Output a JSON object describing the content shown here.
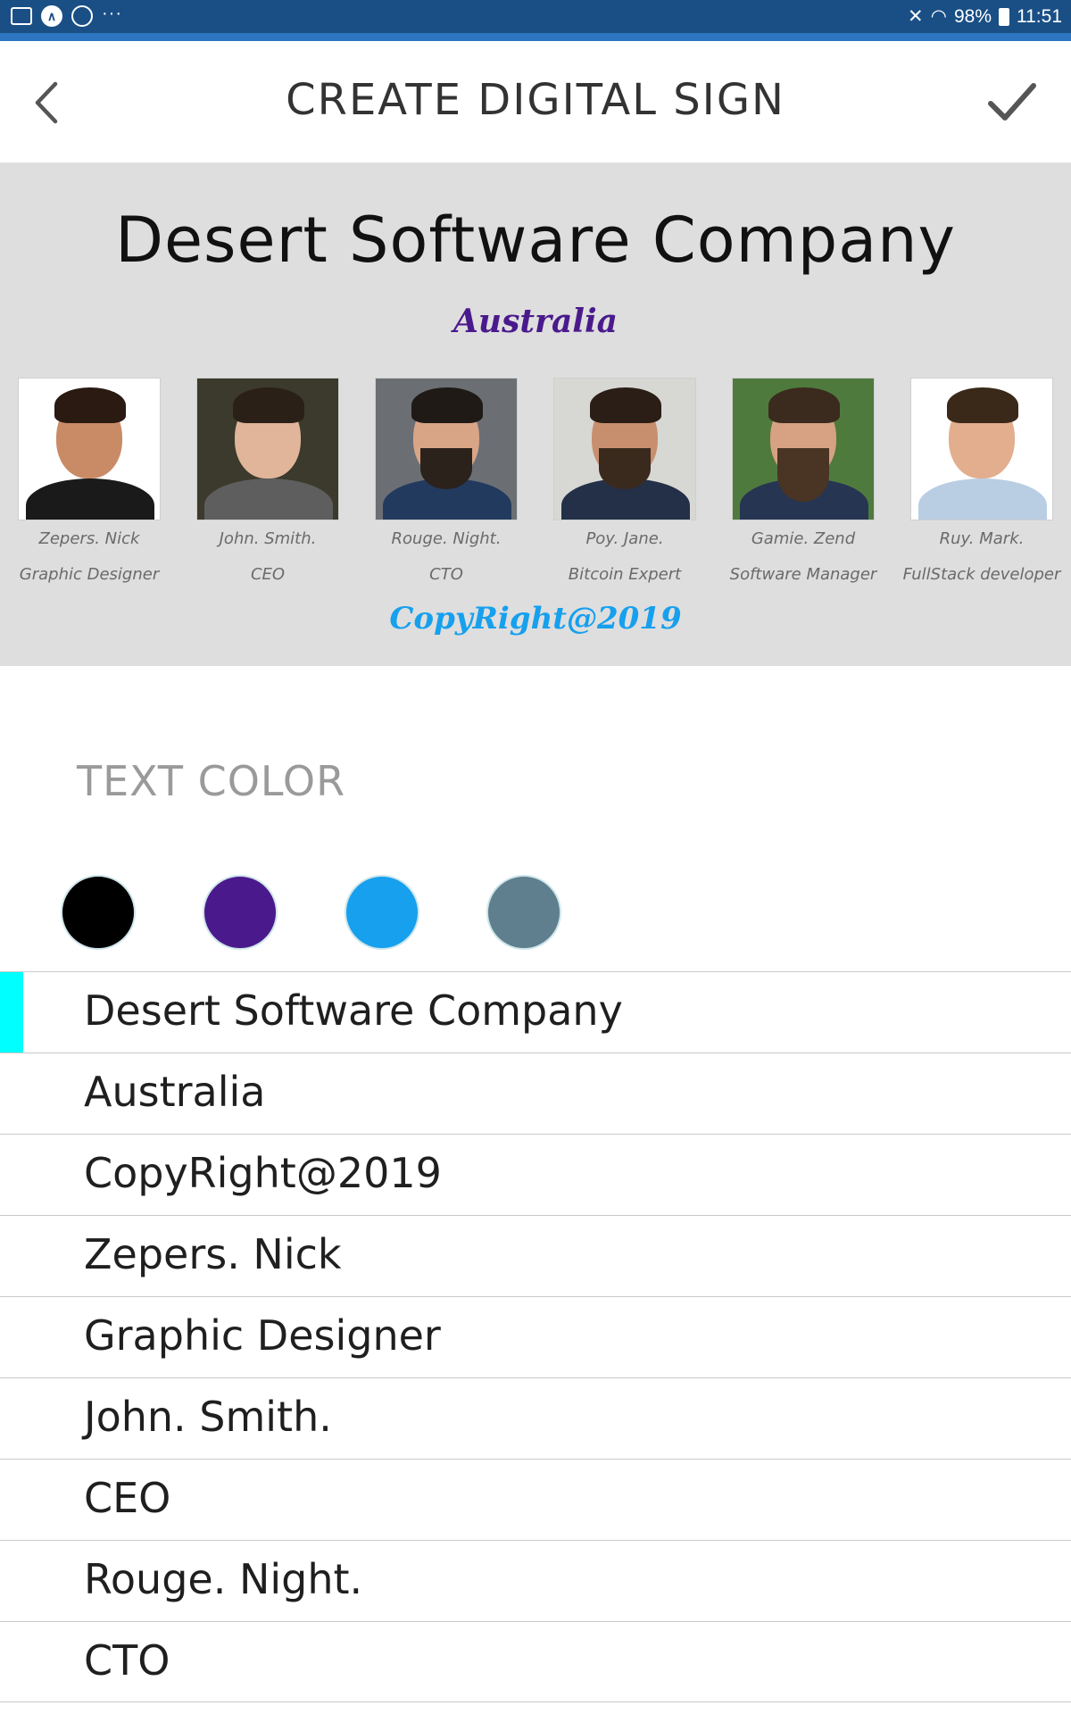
{
  "status_bar": {
    "left_icons": [
      "gallery-icon",
      "app-icon",
      "whatsapp-icon",
      "more-dots-icon"
    ],
    "battery": "98%",
    "time": "11:51"
  },
  "header": {
    "title": "CREATE DIGITAL SIGN",
    "back_icon": "chevron-left-icon",
    "confirm_icon": "checkmark-icon"
  },
  "preview": {
    "company": "Desert Software Company",
    "location": "Australia",
    "copyright": "CopyRight@2019",
    "people": [
      {
        "name": "Zepers. Nick",
        "role": "Graphic Designer"
      },
      {
        "name": "John. Smith.",
        "role": "CEO"
      },
      {
        "name": "Rouge. Night.",
        "role": "CTO"
      },
      {
        "name": "Poy. Jane.",
        "role": "Bitcoin Expert"
      },
      {
        "name": "Gamie. Zend",
        "role": "Software Manager"
      },
      {
        "name": "Ruy. Mark.",
        "role": "FullStack developer"
      }
    ]
  },
  "text_color": {
    "label": "TEXT COLOR",
    "swatches": [
      "#000000",
      "#4a1a8c",
      "#16a0ee",
      "#5f7f8e"
    ]
  },
  "text_items": [
    "Desert Software Company",
    "Australia",
    "CopyRight@2019",
    "Zepers. Nick",
    "Graphic Designer",
    "John. Smith.",
    "CEO",
    "Rouge. Night.",
    "CTO"
  ],
  "colors": {
    "status_bar": "#1a4f86",
    "selection_indicator": "#00ffff",
    "location_text": "#4a1a8c",
    "copyright_text": "#16a0ee"
  }
}
